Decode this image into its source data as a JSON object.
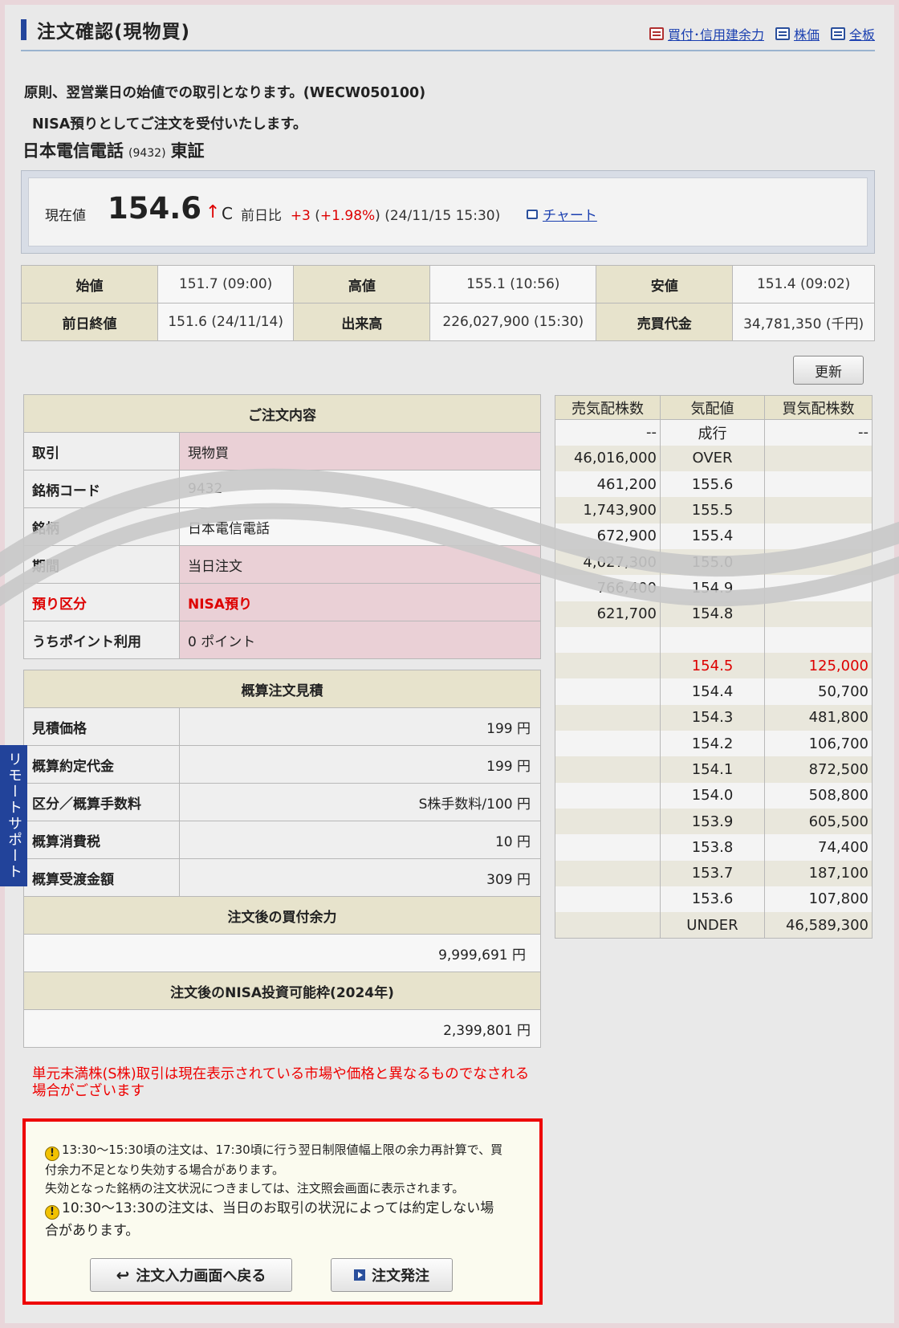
{
  "header": {
    "title": "注文確認(現物買)",
    "links": [
      "買付･信用建余力",
      "株価",
      "全板"
    ]
  },
  "notes": {
    "line1": "原則、翌営業日の始値での取引となります。(WECW050100)",
    "line2": "NISA預りとしてご注文を受付いたします。"
  },
  "stock": {
    "name": "日本電信電話",
    "code": "(9432)",
    "market": "東証"
  },
  "price": {
    "label": "現在値",
    "value": "154.6",
    "arrow": "↑",
    "flag": "C",
    "change_label": "前日比",
    "change": "+3",
    "change_pct": "+1.98%",
    "time": "(24/11/15 15:30)",
    "chart_link": "チャート"
  },
  "ohlc": {
    "open_label": "始値",
    "open_value": "151.7",
    "open_time": "(09:00)",
    "high_label": "高値",
    "high_value": "155.1",
    "high_time": "(10:56)",
    "low_label": "安値",
    "low_value": "151.4",
    "low_time": "(09:02)",
    "prev_label": "前日終値",
    "prev_value": "151.6",
    "prev_time": "(24/11/14)",
    "volume_label": "出来高",
    "volume_value": "226,027,900",
    "volume_time": "(15:30)",
    "turnover_label": "売買代金",
    "turnover_value": "34,781,350",
    "turnover_unit": "(千円)"
  },
  "update_button": "更新",
  "order": {
    "header": "ご注文内容",
    "rows": [
      {
        "key": "取引",
        "value": "現物買"
      },
      {
        "key": "銘柄コード",
        "value": "9432"
      },
      {
        "key": "銘柄",
        "value": "日本電信電話"
      },
      {
        "key": "期間",
        "value": "当日注文"
      },
      {
        "key": "預り区分",
        "value": "NISA預り"
      },
      {
        "key": "うちポイント利用",
        "value": "0 ポイント"
      }
    ]
  },
  "estimate": {
    "header": "概算注文見積",
    "rows": [
      {
        "key": "見積価格",
        "value": "199 円"
      },
      {
        "key": "概算約定代金",
        "value": "199 円"
      },
      {
        "key": "区分／概算手数料",
        "value": "S株手数料/100 円"
      },
      {
        "key": "概算消費税",
        "value": "10 円"
      },
      {
        "key": "概算受渡金額",
        "value": "309 円"
      }
    ],
    "buying_power_header": "注文後の買付余力",
    "buying_power_value": "9,999,691 円",
    "nisa_header": "注文後のNISA投資可能枠(2024年)",
    "nisa_value": "2,399,801 円"
  },
  "orderbook": {
    "headers": [
      "売気配株数",
      "気配値",
      "買気配株数"
    ],
    "rows": [
      {
        "sell": "--",
        "price": "成行",
        "buy": "--"
      },
      {
        "sell": "46,016,000",
        "price": "OVER",
        "buy": ""
      },
      {
        "sell": "461,200",
        "price": "155.6",
        "buy": ""
      },
      {
        "sell": "1,743,900",
        "price": "155.5",
        "buy": ""
      },
      {
        "sell": "672,900",
        "price": "155.4",
        "buy": ""
      },
      {
        "sell": "4,027,300",
        "price": "155.0",
        "buy": ""
      },
      {
        "sell": "766,400",
        "price": "154.9",
        "buy": ""
      },
      {
        "sell": "621,700",
        "price": "154.8",
        "buy": ""
      },
      {
        "sell": "",
        "price": "",
        "buy": ""
      },
      {
        "sell": "",
        "price": "154.5",
        "buy": "125,000"
      },
      {
        "sell": "",
        "price": "154.4",
        "buy": "50,700"
      },
      {
        "sell": "",
        "price": "154.3",
        "buy": "481,800"
      },
      {
        "sell": "",
        "price": "154.2",
        "buy": "106,700"
      },
      {
        "sell": "",
        "price": "154.1",
        "buy": "872,500"
      },
      {
        "sell": "",
        "price": "154.0",
        "buy": "508,800"
      },
      {
        "sell": "",
        "price": "153.9",
        "buy": "605,500"
      },
      {
        "sell": "",
        "price": "153.8",
        "buy": "74,400"
      },
      {
        "sell": "",
        "price": "153.7",
        "buy": "187,100"
      },
      {
        "sell": "",
        "price": "153.6",
        "buy": "107,800"
      },
      {
        "sell": "",
        "price": "UNDER",
        "buy": "46,589,300"
      }
    ]
  },
  "warning_red": "単元未満株(S株)取引は現在表示されている市場や価格と異なるものでなされる場合がございます",
  "notice": {
    "p1_line1": "13:30〜15:30頃の注文は、17:30頃に行う翌日制限値幅上限の余力再計算で、買",
    "p1_line2": "付余力不足となり失効する場合があります。",
    "p1_line3": "失効となった銘柄の注文状況につきましては、注文照会画面に表示されます。",
    "p2_line1": "10:30〜13:30の注文は、当日のお取引の状況によっては約定しない場",
    "p2_line2": "合があります。"
  },
  "buttons": {
    "back": "注文入力画面へ戻る",
    "submit": "注文発注"
  },
  "remote_support": "リモートサポート",
  "colors": {
    "accent": "#23459c",
    "warning": "#e00000",
    "header_bg": "#e7e3cc"
  }
}
